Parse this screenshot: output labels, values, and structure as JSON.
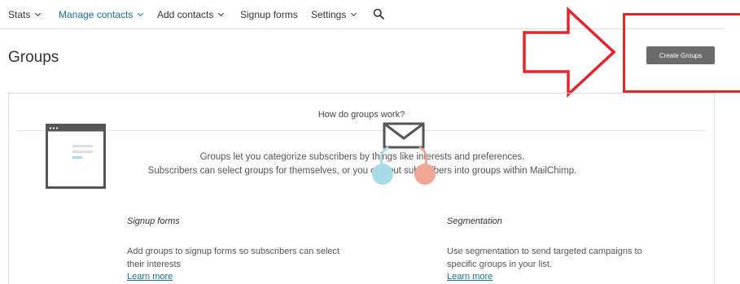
{
  "nav": {
    "items": [
      {
        "label": "Stats",
        "dropdown": true
      },
      {
        "label": "Manage contacts",
        "dropdown": true,
        "active": true
      },
      {
        "label": "Add contacts",
        "dropdown": true
      },
      {
        "label": "Signup forms",
        "dropdown": false
      },
      {
        "label": "Settings",
        "dropdown": true
      }
    ],
    "search_icon": "search-icon"
  },
  "page": {
    "title": "Groups",
    "create_button": "Create Groups"
  },
  "panel": {
    "heading": "How do groups work?",
    "intro_line1": "Groups let you categorize subscribers by things like interests and preferences.",
    "intro_line2": "Subscribers can select groups for themselves, or you can put subscribers into groups within MailChimp.",
    "features": [
      {
        "title": "Signup forms",
        "text": "Add groups to signup forms so subscribers can select their interests",
        "link": "Learn more",
        "icon": "signup-form-icon"
      },
      {
        "title": "Segmentation",
        "text": "Use segmentation to send targeted campaigns to specific groups in your list.",
        "link": "Learn more",
        "icon": "segmentation-icon"
      }
    ]
  },
  "colors": {
    "accent": "#1e6f94",
    "button": "#6b6b6b",
    "annotation_red": "#e3262c",
    "circle_blue": "#a8dbe8",
    "circle_pink": "#f2a696"
  }
}
